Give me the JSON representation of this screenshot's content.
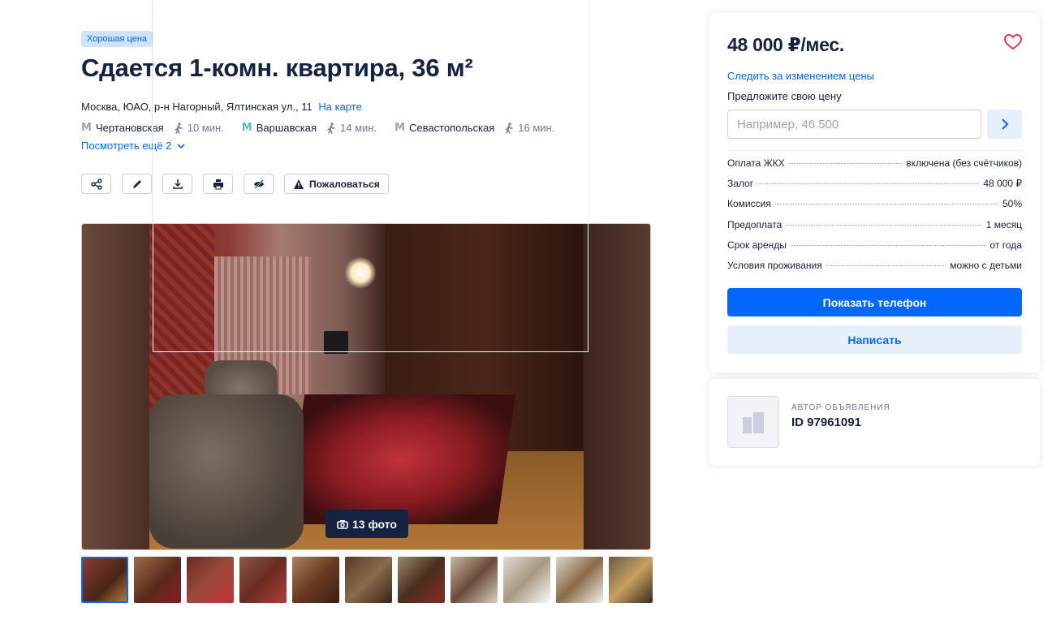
{
  "listing": {
    "badge": "Хорошая цена",
    "title": "Сдается 1-комн. квартира, 36 м²",
    "address": "Москва, ЮАО, р-н Нагорный, Ялтинская ул., 11",
    "map_link": "На карте",
    "metro": [
      {
        "name": "Чертановская",
        "time": "10 мин.",
        "color": "#9aa3b6"
      },
      {
        "name": "Варшавская",
        "time": "14 мин.",
        "color": "#4fc3c0"
      },
      {
        "name": "Севастопольская",
        "time": "16 мин.",
        "color": "#9aa3b6"
      }
    ],
    "more_metro": "Посмотреть ещё 2",
    "actions": {
      "report": "Пожаловаться"
    },
    "photo_count": "13 фото",
    "thumbs_count": 11
  },
  "sidebar": {
    "price": "48 000 ₽/мес.",
    "track_price": "Следить за изменением цены",
    "offer_label": "Предложите свою цену",
    "offer_placeholder": "Например, 46 500",
    "terms": [
      {
        "label": "Оплата ЖКХ",
        "value": "включена (без счётчиков)"
      },
      {
        "label": "Залог",
        "value": "48 000 ₽"
      },
      {
        "label": "Комиссия",
        "value": "50%"
      },
      {
        "label": "Предоплата",
        "value": "1 месяц"
      },
      {
        "label": "Срок аренды",
        "value": "от года"
      },
      {
        "label": "Условия проживания",
        "value": "можно с детьми"
      }
    ],
    "show_phone": "Показать телефон",
    "write": "Написать"
  },
  "author": {
    "role": "Автор объявления",
    "id": "ID 97961091"
  },
  "colors": {
    "accent": "#0468ff",
    "text": "#152242",
    "muted": "#707a95",
    "heart": "#e8345a"
  }
}
